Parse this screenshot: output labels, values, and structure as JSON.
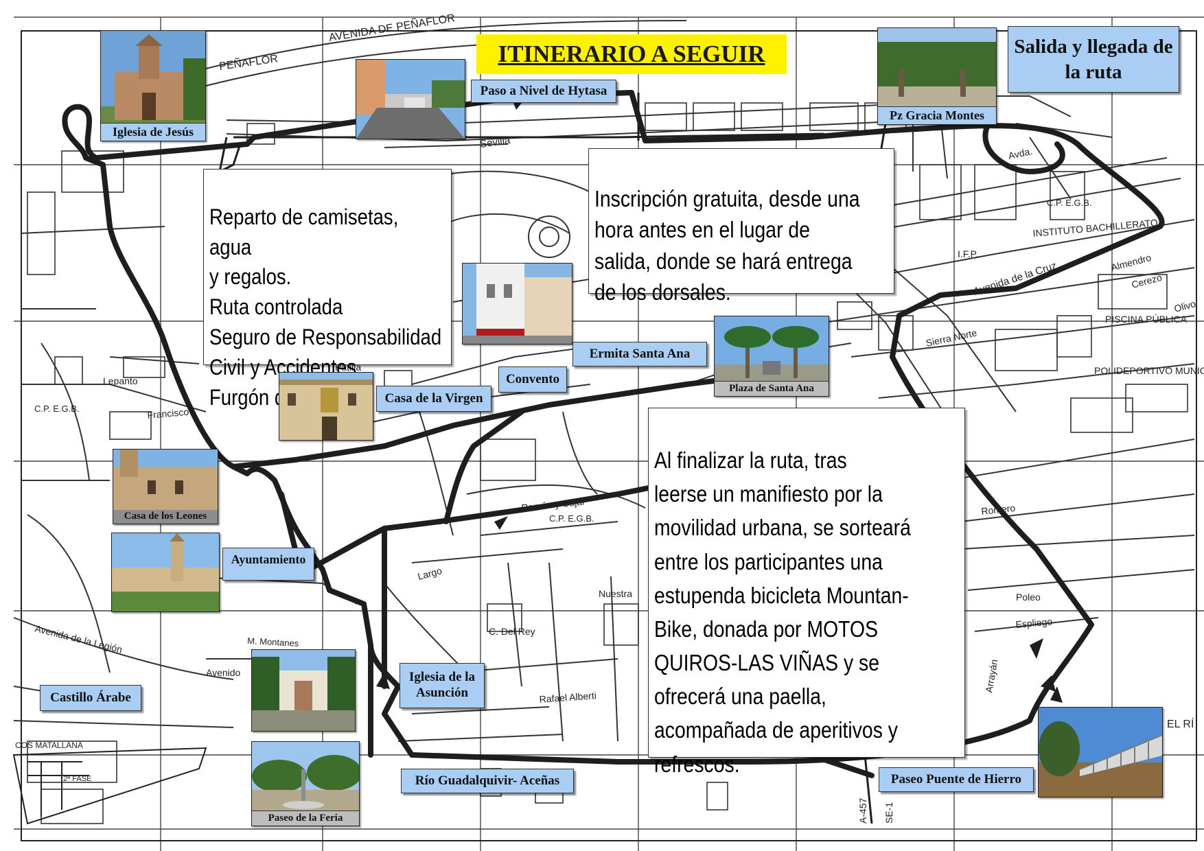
{
  "title": "ITINERARIO A SEGUIR",
  "start_label": "Salida y llegada de la ruta",
  "info": {
    "services": "Reparto de camisetas, agua\ny regalos.\nRuta controlada\nSeguro de Responsabilidad\nCivil y Accidentes.\nFurgón de Apoyo",
    "registration": "Inscripción gratuita, desde una\nhora antes en el lugar de\nsalida, donde se hará entrega\nde los dorsales.",
    "closing": "Al finalizar la ruta, tras\nleerse un manifiesto por la\nmovilidad urbana, se sorteará\nentre los participantes una\nestupenda bicicleta Mountan-\nBike, donada por MOTOS\nQUIROS-LAS VIÑAS y se\nofrecerá una paella,\nacompañada de aperitivos y\nrefrescos."
  },
  "landmarks": {
    "iglesia_jesus": "Iglesia de Jesús",
    "paso_nivel": "Paso a Nivel de Hytasa",
    "pz_gracia": "Pz Gracia Montes",
    "ermita": "Ermita Santa Ana",
    "convento": "Convento",
    "plaza_santa_ana": "Plaza de Santa Ana",
    "casa_virgen": "Casa de la Virgen",
    "casa_leones": "Casa de los Leones",
    "ayuntamiento": "Ayuntamiento",
    "castillo": "Castillo Árabe",
    "iglesia_asuncion": "Iglesia de la Asunción",
    "rio": "Río Guadalquivir- Aceñas",
    "paseo_feria": "Paseo de la Feria",
    "puente_hierro": "Paseo Puente de Hierro"
  },
  "map_labels": {
    "avenida_penaflor": "AVENIDA DE PEÑAFLOR",
    "penaflor": "PEÑAFLOR",
    "sevilla": "Sevilla",
    "instituto": "INSTITUTO BACHILLERATO",
    "ifp": "I.F.P.",
    "piscina": "PISCINA PÚBLICA",
    "polideportivo": "POLIDEPORTIVO MUNICIPAL",
    "cp_egb": "C.P. E.G.B.",
    "avenida_cruz": "Avenida de la Cruz",
    "almendro": "Almendro",
    "cerezo": "Cerezo",
    "olivo": "Olivo",
    "romero": "Romero",
    "poleo": "Poleo",
    "espliego": "Espliego",
    "arrayan": "Arrayán",
    "calle_rey": "C. Del Rey",
    "nuestra": "Nuestra",
    "rafael_alberti": "Rafael Alberti",
    "matallana": "COS MATALLANA",
    "fase": "2ª FASE",
    "a457": "A-457",
    "se1": "SE-1",
    "el_rio": "EL RÍ",
    "avda": "Avda.",
    "largo": "Largo",
    "avenido": "Avenido",
    "ramon_cajal": "Ramón y Cajal",
    "sierra_norte": "Sierra Norte",
    "patilla": "Patilla",
    "lepanto": "Lepanto",
    "francisco": "Francisco",
    "montanes": "M. Montanes",
    "avenida_legion": "Avenida de la Legión"
  },
  "colors": {
    "tag_bg": "#a9cdf3",
    "title_bg": "#fff200",
    "route": "#222222",
    "streets": "#333333"
  }
}
